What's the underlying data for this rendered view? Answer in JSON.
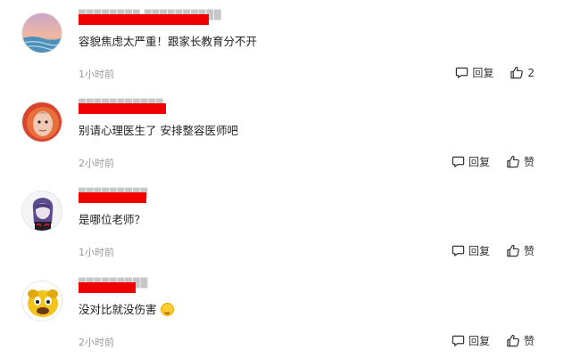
{
  "comments": [
    {
      "username_hidden": "████████  ██████████",
      "text": "容貌焦虑太严重！跟家长教育分不开",
      "time": "1小时前",
      "reply_label": "回复",
      "like_label": "2",
      "avatar": "sea-sunset"
    },
    {
      "username_hidden": "███████████",
      "text": "别请心理医生了 安排整容医师吧",
      "time": "2小时前",
      "reply_label": "回复",
      "like_label": "赞",
      "avatar": "man-portrait"
    },
    {
      "username_hidden": "█████████",
      "text": "是哪位老师？",
      "time": "1小时前",
      "reply_label": "回复",
      "like_label": "赞",
      "avatar": "anime-character"
    },
    {
      "username_hidden": "█████████",
      "text": "没对比就没伤害",
      "time": "2小时前",
      "reply_label": "回复",
      "like_label": "赞",
      "avatar": "cartoon-dog"
    }
  ],
  "icons": {
    "reply": "comment-bubble-icon",
    "like": "thumbs-up-icon",
    "emoji": "laughing-emoji-icon"
  },
  "colors": {
    "redaction": "#f10000",
    "meta_text": "#9a9a9a"
  }
}
